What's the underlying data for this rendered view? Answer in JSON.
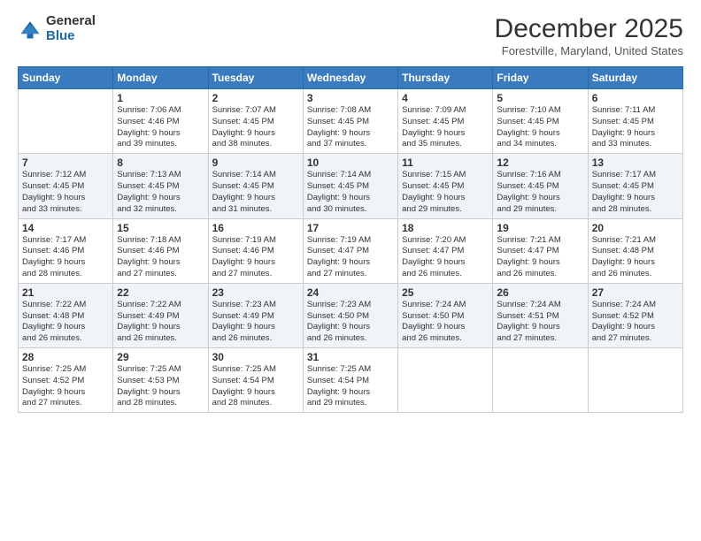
{
  "logo": {
    "general": "General",
    "blue": "Blue"
  },
  "title": "December 2025",
  "subtitle": "Forestville, Maryland, United States",
  "days_of_week": [
    "Sunday",
    "Monday",
    "Tuesday",
    "Wednesday",
    "Thursday",
    "Friday",
    "Saturday"
  ],
  "weeks": [
    [
      {
        "day": "",
        "info": ""
      },
      {
        "day": "1",
        "info": "Sunrise: 7:06 AM\nSunset: 4:46 PM\nDaylight: 9 hours\nand 39 minutes."
      },
      {
        "day": "2",
        "info": "Sunrise: 7:07 AM\nSunset: 4:45 PM\nDaylight: 9 hours\nand 38 minutes."
      },
      {
        "day": "3",
        "info": "Sunrise: 7:08 AM\nSunset: 4:45 PM\nDaylight: 9 hours\nand 37 minutes."
      },
      {
        "day": "4",
        "info": "Sunrise: 7:09 AM\nSunset: 4:45 PM\nDaylight: 9 hours\nand 35 minutes."
      },
      {
        "day": "5",
        "info": "Sunrise: 7:10 AM\nSunset: 4:45 PM\nDaylight: 9 hours\nand 34 minutes."
      },
      {
        "day": "6",
        "info": "Sunrise: 7:11 AM\nSunset: 4:45 PM\nDaylight: 9 hours\nand 33 minutes."
      }
    ],
    [
      {
        "day": "7",
        "info": "Sunrise: 7:12 AM\nSunset: 4:45 PM\nDaylight: 9 hours\nand 33 minutes."
      },
      {
        "day": "8",
        "info": "Sunrise: 7:13 AM\nSunset: 4:45 PM\nDaylight: 9 hours\nand 32 minutes."
      },
      {
        "day": "9",
        "info": "Sunrise: 7:14 AM\nSunset: 4:45 PM\nDaylight: 9 hours\nand 31 minutes."
      },
      {
        "day": "10",
        "info": "Sunrise: 7:14 AM\nSunset: 4:45 PM\nDaylight: 9 hours\nand 30 minutes."
      },
      {
        "day": "11",
        "info": "Sunrise: 7:15 AM\nSunset: 4:45 PM\nDaylight: 9 hours\nand 29 minutes."
      },
      {
        "day": "12",
        "info": "Sunrise: 7:16 AM\nSunset: 4:45 PM\nDaylight: 9 hours\nand 29 minutes."
      },
      {
        "day": "13",
        "info": "Sunrise: 7:17 AM\nSunset: 4:45 PM\nDaylight: 9 hours\nand 28 minutes."
      }
    ],
    [
      {
        "day": "14",
        "info": "Sunrise: 7:17 AM\nSunset: 4:46 PM\nDaylight: 9 hours\nand 28 minutes."
      },
      {
        "day": "15",
        "info": "Sunrise: 7:18 AM\nSunset: 4:46 PM\nDaylight: 9 hours\nand 27 minutes."
      },
      {
        "day": "16",
        "info": "Sunrise: 7:19 AM\nSunset: 4:46 PM\nDaylight: 9 hours\nand 27 minutes."
      },
      {
        "day": "17",
        "info": "Sunrise: 7:19 AM\nSunset: 4:47 PM\nDaylight: 9 hours\nand 27 minutes."
      },
      {
        "day": "18",
        "info": "Sunrise: 7:20 AM\nSunset: 4:47 PM\nDaylight: 9 hours\nand 26 minutes."
      },
      {
        "day": "19",
        "info": "Sunrise: 7:21 AM\nSunset: 4:47 PM\nDaylight: 9 hours\nand 26 minutes."
      },
      {
        "day": "20",
        "info": "Sunrise: 7:21 AM\nSunset: 4:48 PM\nDaylight: 9 hours\nand 26 minutes."
      }
    ],
    [
      {
        "day": "21",
        "info": "Sunrise: 7:22 AM\nSunset: 4:48 PM\nDaylight: 9 hours\nand 26 minutes."
      },
      {
        "day": "22",
        "info": "Sunrise: 7:22 AM\nSunset: 4:49 PM\nDaylight: 9 hours\nand 26 minutes."
      },
      {
        "day": "23",
        "info": "Sunrise: 7:23 AM\nSunset: 4:49 PM\nDaylight: 9 hours\nand 26 minutes."
      },
      {
        "day": "24",
        "info": "Sunrise: 7:23 AM\nSunset: 4:50 PM\nDaylight: 9 hours\nand 26 minutes."
      },
      {
        "day": "25",
        "info": "Sunrise: 7:24 AM\nSunset: 4:50 PM\nDaylight: 9 hours\nand 26 minutes."
      },
      {
        "day": "26",
        "info": "Sunrise: 7:24 AM\nSunset: 4:51 PM\nDaylight: 9 hours\nand 27 minutes."
      },
      {
        "day": "27",
        "info": "Sunrise: 7:24 AM\nSunset: 4:52 PM\nDaylight: 9 hours\nand 27 minutes."
      }
    ],
    [
      {
        "day": "28",
        "info": "Sunrise: 7:25 AM\nSunset: 4:52 PM\nDaylight: 9 hours\nand 27 minutes."
      },
      {
        "day": "29",
        "info": "Sunrise: 7:25 AM\nSunset: 4:53 PM\nDaylight: 9 hours\nand 28 minutes."
      },
      {
        "day": "30",
        "info": "Sunrise: 7:25 AM\nSunset: 4:54 PM\nDaylight: 9 hours\nand 28 minutes."
      },
      {
        "day": "31",
        "info": "Sunrise: 7:25 AM\nSunset: 4:54 PM\nDaylight: 9 hours\nand 29 minutes."
      },
      {
        "day": "",
        "info": ""
      },
      {
        "day": "",
        "info": ""
      },
      {
        "day": "",
        "info": ""
      }
    ]
  ]
}
